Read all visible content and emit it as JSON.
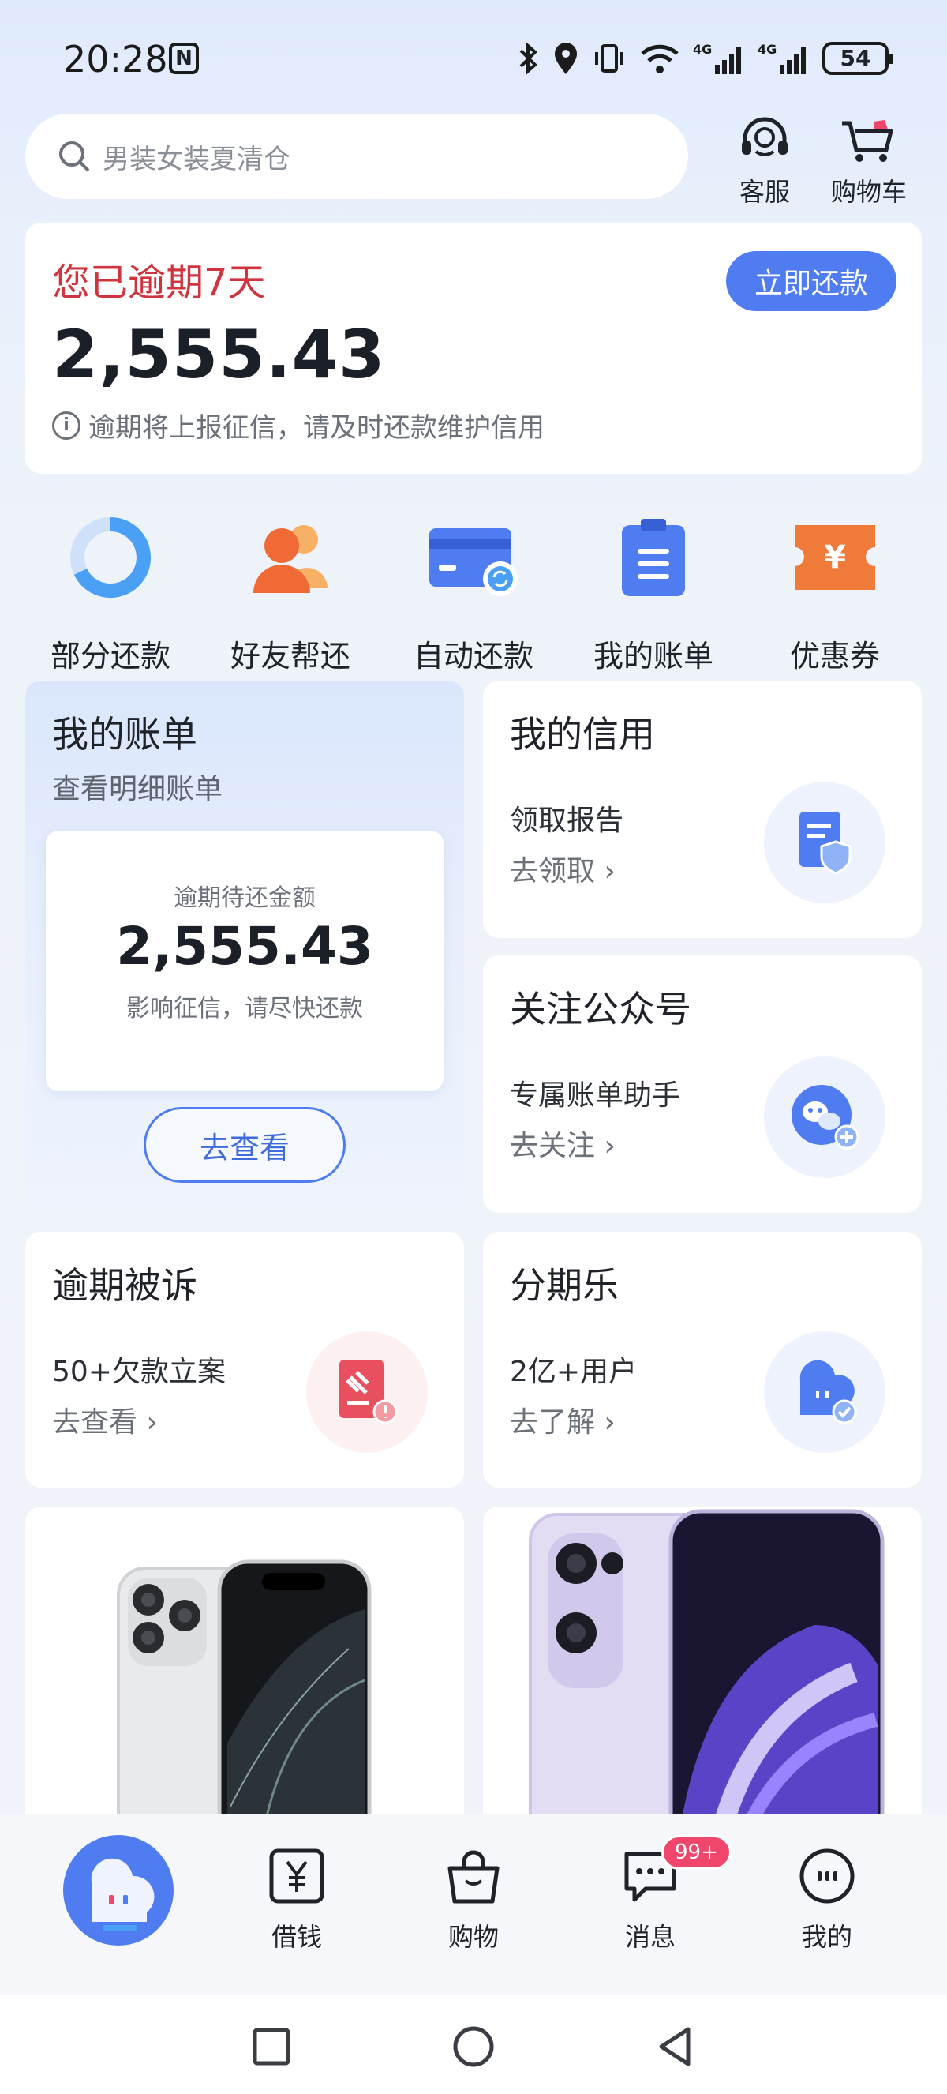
{
  "status_bar": {
    "time": "20:28",
    "nfc": "N",
    "battery": "54"
  },
  "search": {
    "placeholder": "男装女装夏清仓"
  },
  "top_actions": {
    "service": "客服",
    "cart": "购物车"
  },
  "overdue": {
    "title": "您已逾期7天",
    "amount": "2,555.43",
    "note": "逾期将上报征信，请及时还款维护信用",
    "button": "立即还款"
  },
  "quick_actions": [
    {
      "label": "部分还款",
      "icon": "donut-icon"
    },
    {
      "label": "好友帮还",
      "icon": "friends-icon"
    },
    {
      "label": "自动还款",
      "icon": "card-refresh-icon"
    },
    {
      "label": "我的账单",
      "icon": "clipboard-icon"
    },
    {
      "label": "优惠券",
      "icon": "coupon-icon"
    }
  ],
  "bill_card": {
    "title": "我的账单",
    "subtitle": "查看明细账单",
    "inner_label": "逾期待还金额",
    "inner_amount": "2,555.43",
    "inner_note": "影响征信，请尽快还款",
    "button": "去查看"
  },
  "credit_card": {
    "title": "我的信用",
    "sub": "领取报告",
    "link": "去领取"
  },
  "follow_card": {
    "title": "关注公众号",
    "sub": "专属账单助手",
    "link": "去关注"
  },
  "lawsuit_card": {
    "title": "逾期被诉",
    "sub": "50+欠款立案",
    "link": "去查看"
  },
  "installment_card": {
    "title": "分期乐",
    "sub": "2亿+用户",
    "link": "去了解"
  },
  "bottom_nav": {
    "borrow": "借钱",
    "shop": "购物",
    "messages": "消息",
    "messages_badge": "99+",
    "mine": "我的"
  },
  "colors": {
    "accent": "#4f7cf0",
    "danger": "#d0353f",
    "orange": "#f07a3a"
  }
}
